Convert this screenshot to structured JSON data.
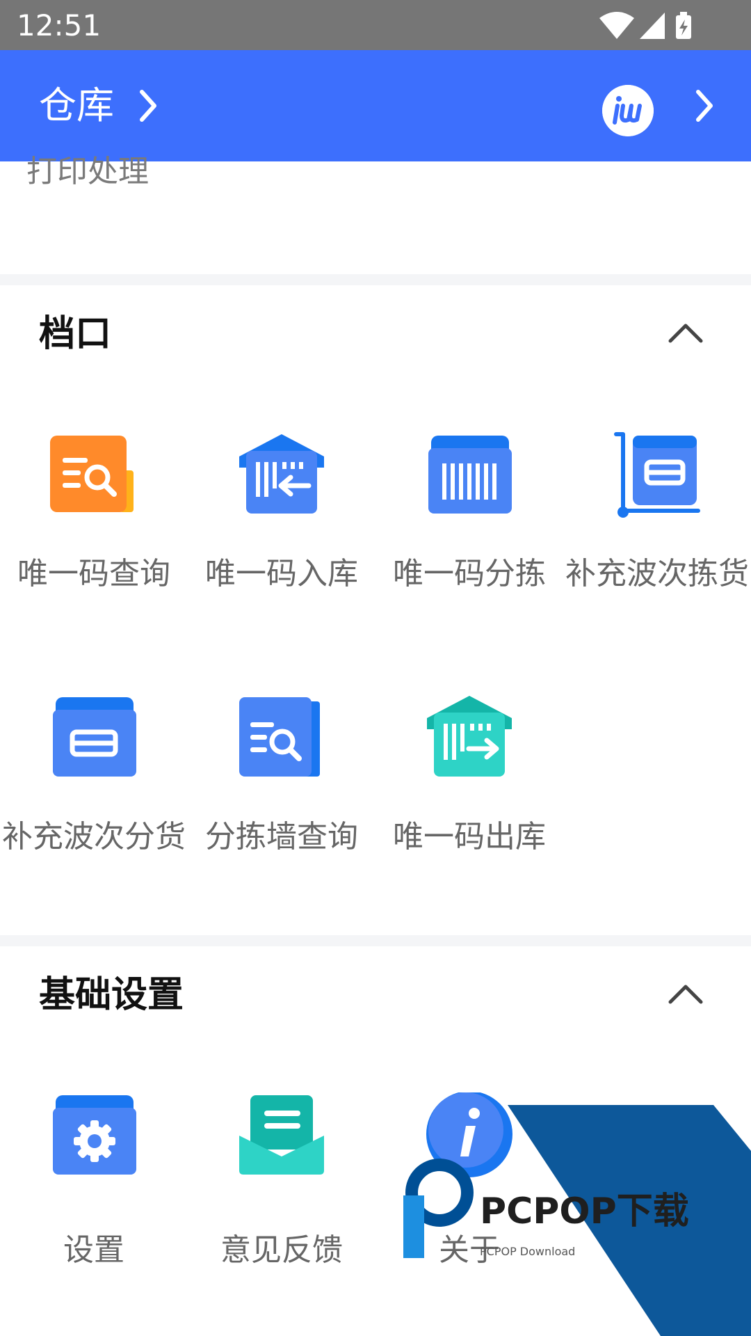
{
  "status_bar": {
    "time": "12:51"
  },
  "app_bar": {
    "title": "仓库"
  },
  "sections": {
    "print": {
      "item_label": "打印处理"
    },
    "dangkou": {
      "title": "档口",
      "items": [
        {
          "label": "唯一码查询"
        },
        {
          "label": "唯一码入库"
        },
        {
          "label": "唯一码分拣"
        },
        {
          "label": "补充波次拣货"
        },
        {
          "label": "补充波次分货"
        },
        {
          "label": "分拣墙查询"
        },
        {
          "label": "唯一码出库"
        }
      ]
    },
    "basic": {
      "title": "基础设置",
      "items": [
        {
          "label": "设置"
        },
        {
          "label": "意见反馈"
        },
        {
          "label": "关于"
        }
      ]
    }
  },
  "watermark": {
    "brand": "PCPOP下载",
    "sub": "PCPOP Download"
  },
  "colors": {
    "primary": "#3d6ffd",
    "orange": "#ff8a2a",
    "teal": "#2ed3c6",
    "watermark": "#004f95"
  }
}
